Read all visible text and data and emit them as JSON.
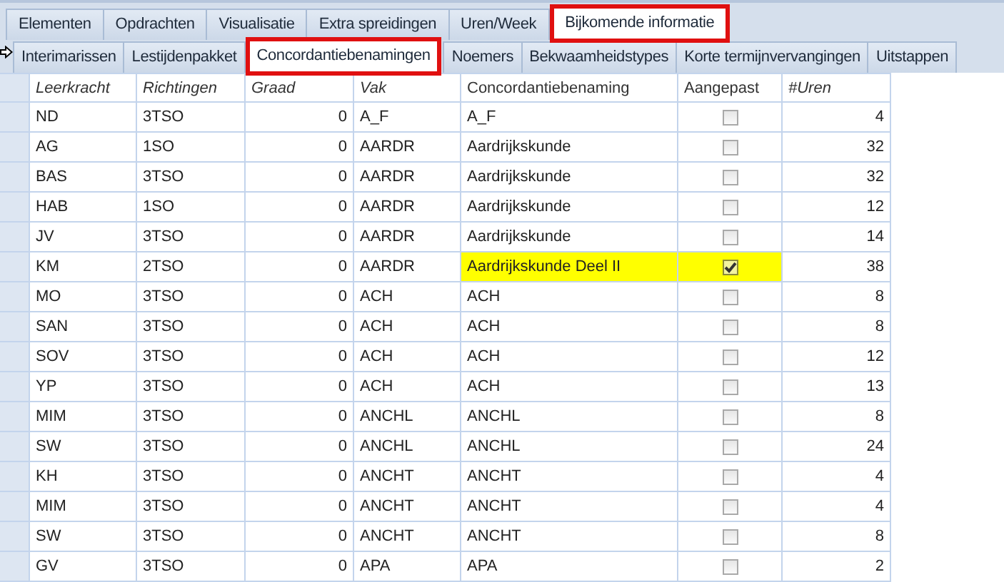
{
  "main_tabs": [
    {
      "label": "Elementen",
      "selected": false,
      "highlighted": false
    },
    {
      "label": "Opdrachten",
      "selected": false,
      "highlighted": false
    },
    {
      "label": "Visualisatie",
      "selected": false,
      "highlighted": false
    },
    {
      "label": "Extra spreidingen",
      "selected": false,
      "highlighted": false
    },
    {
      "label": "Uren/Week",
      "selected": false,
      "highlighted": false
    },
    {
      "label": "Bijkomende informatie",
      "selected": true,
      "highlighted": true
    }
  ],
  "sub_tabs": [
    {
      "label": "Interimarissen",
      "selected": false,
      "highlighted": false
    },
    {
      "label": "Lestijdenpakket",
      "selected": false,
      "highlighted": false
    },
    {
      "label": "Concordantiebenamingen",
      "selected": true,
      "highlighted": true
    },
    {
      "label": "Noemers",
      "selected": false,
      "highlighted": false
    },
    {
      "label": "Bekwaamheidstypes",
      "selected": false,
      "highlighted": false
    },
    {
      "label": "Korte termijnvervangingen",
      "selected": false,
      "highlighted": false
    },
    {
      "label": "Uitstappen",
      "selected": false,
      "highlighted": false
    }
  ],
  "table": {
    "columns": [
      {
        "label": "Leerkracht",
        "italic": true
      },
      {
        "label": "Richtingen",
        "italic": true
      },
      {
        "label": "Graad",
        "italic": true
      },
      {
        "label": "Vak",
        "italic": true
      },
      {
        "label": "Concordantiebenaming",
        "italic": false
      },
      {
        "label": "Aangepast",
        "italic": false
      },
      {
        "label": "#Uren",
        "italic": true
      }
    ],
    "rows": [
      {
        "leerkracht": "ND",
        "richtingen": "3TSO",
        "graad": "0",
        "vak": "A_F",
        "benaming": "A_F",
        "aangepast": false,
        "uren": "4"
      },
      {
        "leerkracht": "AG",
        "richtingen": "1SO",
        "graad": "0",
        "vak": "AARDR",
        "benaming": "Aardrijkskunde",
        "aangepast": false,
        "uren": "32"
      },
      {
        "leerkracht": "BAS",
        "richtingen": "3TSO",
        "graad": "0",
        "vak": "AARDR",
        "benaming": "Aardrijkskunde",
        "aangepast": false,
        "uren": "32"
      },
      {
        "leerkracht": "HAB",
        "richtingen": "1SO",
        "graad": "0",
        "vak": "AARDR",
        "benaming": "Aardrijkskunde",
        "aangepast": false,
        "uren": "12"
      },
      {
        "leerkracht": "JV",
        "richtingen": "3TSO",
        "graad": "0",
        "vak": "AARDR",
        "benaming": "Aardrijkskunde",
        "aangepast": false,
        "uren": "14"
      },
      {
        "leerkracht": "KM",
        "richtingen": "2TSO",
        "graad": "0",
        "vak": "AARDR",
        "benaming": "Aardrijkskunde Deel II",
        "aangepast": true,
        "uren": "38"
      },
      {
        "leerkracht": "MO",
        "richtingen": "3TSO",
        "graad": "0",
        "vak": "ACH",
        "benaming": "ACH",
        "aangepast": false,
        "uren": "8"
      },
      {
        "leerkracht": "SAN",
        "richtingen": "3TSO",
        "graad": "0",
        "vak": "ACH",
        "benaming": "ACH",
        "aangepast": false,
        "uren": "8"
      },
      {
        "leerkracht": "SOV",
        "richtingen": "3TSO",
        "graad": "0",
        "vak": "ACH",
        "benaming": "ACH",
        "aangepast": false,
        "uren": "12"
      },
      {
        "leerkracht": "YP",
        "richtingen": "3TSO",
        "graad": "0",
        "vak": "ACH",
        "benaming": "ACH",
        "aangepast": false,
        "uren": "13"
      },
      {
        "leerkracht": "MIM",
        "richtingen": "3TSO",
        "graad": "0",
        "vak": "ANCHL",
        "benaming": "ANCHL",
        "aangepast": false,
        "uren": "8"
      },
      {
        "leerkracht": "SW",
        "richtingen": "3TSO",
        "graad": "0",
        "vak": "ANCHL",
        "benaming": "ANCHL",
        "aangepast": false,
        "uren": "24"
      },
      {
        "leerkracht": "KH",
        "richtingen": "3TSO",
        "graad": "0",
        "vak": "ANCHT",
        "benaming": "ANCHT",
        "aangepast": false,
        "uren": "4"
      },
      {
        "leerkracht": "MIM",
        "richtingen": "3TSO",
        "graad": "0",
        "vak": "ANCHT",
        "benaming": "ANCHT",
        "aangepast": false,
        "uren": "4"
      },
      {
        "leerkracht": "SW",
        "richtingen": "3TSO",
        "graad": "0",
        "vak": "ANCHT",
        "benaming": "ANCHT",
        "aangepast": false,
        "uren": "8"
      },
      {
        "leerkracht": "GV",
        "richtingen": "3TSO",
        "graad": "0",
        "vak": "APA",
        "benaming": "APA",
        "aangepast": false,
        "uren": "2"
      }
    ]
  }
}
